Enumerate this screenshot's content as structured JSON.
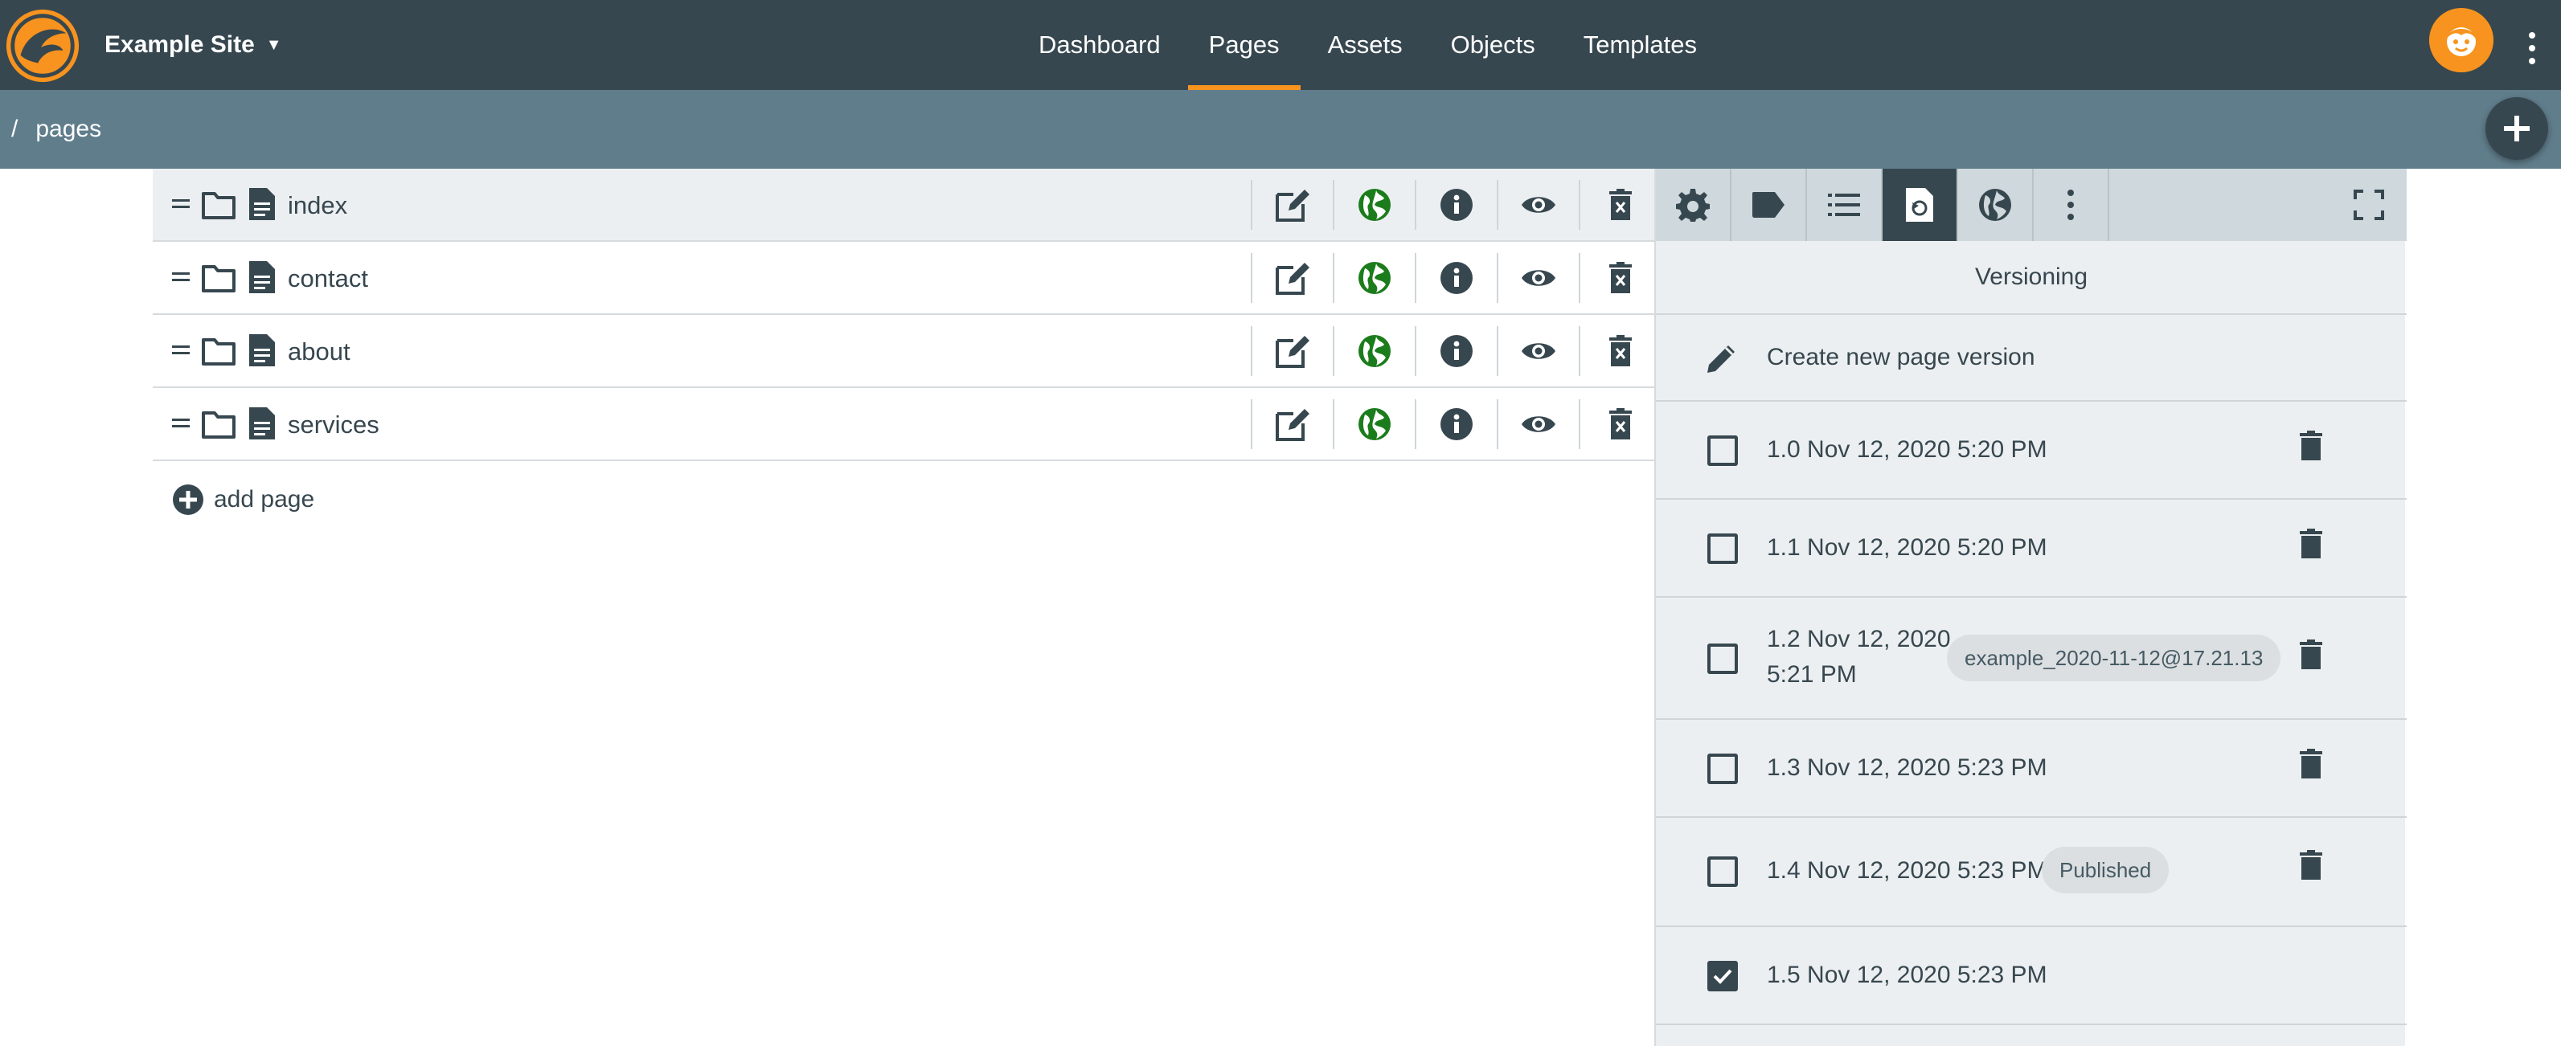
{
  "header": {
    "site_name": "Example Site",
    "site_caret": "▼",
    "nav": [
      "Dashboard",
      "Pages",
      "Assets",
      "Objects",
      "Templates"
    ],
    "active_nav": "Pages",
    "brand_color": "#f7931e"
  },
  "breadcrumb": {
    "separator": "/",
    "current": "pages"
  },
  "pages": [
    {
      "name": "index",
      "selected": true
    },
    {
      "name": "contact",
      "selected": false
    },
    {
      "name": "about",
      "selected": false
    },
    {
      "name": "services",
      "selected": false
    }
  ],
  "add_page_label": "add page",
  "panel": {
    "title": "Versioning",
    "tabs": [
      "gear-icon",
      "tag-icon",
      "list-icon",
      "versions-icon",
      "globe-icon",
      "more-icon"
    ],
    "active_tab": "versions-icon",
    "create_label": "Create new page version",
    "versions": [
      {
        "text": "1.0 Nov 12, 2020 5:20 PM",
        "checked": false,
        "tag": ""
      },
      {
        "text": "1.1 Nov 12, 2020 5:20 PM",
        "checked": false,
        "tag": ""
      },
      {
        "text_line1": "1.2 Nov 12, 2020",
        "text_line2": "5:21 PM",
        "checked": false,
        "tag": "example_2020-11-12@17.21.13"
      },
      {
        "text": "1.3 Nov 12, 2020 5:23 PM",
        "checked": false,
        "tag": ""
      },
      {
        "text": "1.4 Nov 12, 2020 5:23 PM",
        "checked": false,
        "tag": "Published"
      },
      {
        "text": "1.5 Nov 12, 2020 5:23 PM",
        "checked": true,
        "tag": ""
      }
    ]
  }
}
